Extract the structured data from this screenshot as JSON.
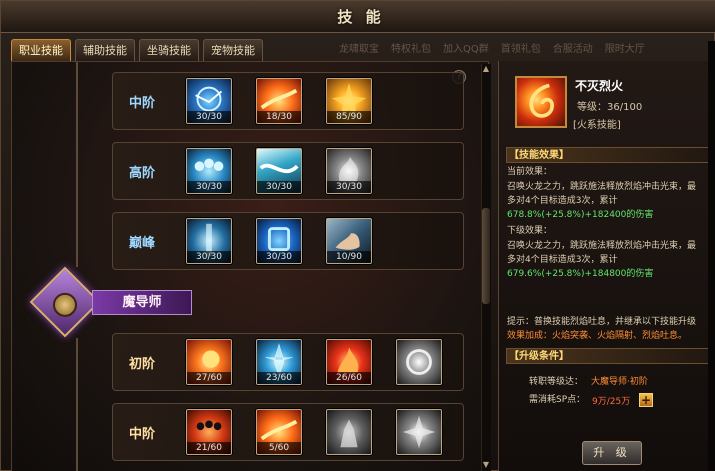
{
  "window": {
    "title": "技 能"
  },
  "tabs": [
    "职业技能",
    "辅助技能",
    "坐骑技能",
    "宠物技能"
  ],
  "top_strip": [
    "龙啸取宝",
    "特权礼包",
    "加入QQ群",
    "首领礼包",
    "合服活动",
    "限时大厅"
  ],
  "help": "?",
  "class_name": "魔导师",
  "tiers": [
    {
      "name": "中阶",
      "skills": [
        {
          "level": "30/30",
          "icon": "lightning-orb-icon"
        },
        {
          "level": "18/30",
          "icon": "fire-slash-icon"
        },
        {
          "level": "85/90",
          "icon": "golden-burst-icon"
        }
      ]
    },
    {
      "name": "高阶",
      "skills": [
        {
          "level": "30/30",
          "icon": "group-buff-icon"
        },
        {
          "level": "30/30",
          "icon": "wind-wave-icon"
        },
        {
          "level": "30/30",
          "icon": "smoke-strike-icon"
        }
      ]
    },
    {
      "name": "巅峰",
      "skills": [
        {
          "level": "30/30",
          "icon": "blue-pillar-icon"
        },
        {
          "level": "30/30",
          "icon": "blue-shield-icon"
        },
        {
          "level": "10/90",
          "icon": "strength-arm-icon"
        }
      ]
    },
    {
      "name": "初阶",
      "skills": [
        {
          "level": "27/60",
          "icon": "fireball-icon"
        },
        {
          "level": "23/60",
          "icon": "ice-shards-icon"
        },
        {
          "level": "26/60",
          "icon": "flame-burst-icon"
        },
        {
          "level": "",
          "icon": "locked-vortex-icon"
        }
      ]
    },
    {
      "name": "中阶",
      "skills": [
        {
          "level": "21/60",
          "icon": "fire-army-icon"
        },
        {
          "level": "5/60",
          "icon": "fire-slash-icon"
        },
        {
          "level": "",
          "icon": "locked-warrior-icon"
        },
        {
          "level": "",
          "icon": "locked-burst-icon"
        }
      ]
    }
  ],
  "detail": {
    "name": "不灭烈火",
    "level": "等级：36/100",
    "type": "[火系技能]",
    "effect_header": "【技能效果】",
    "current_title": "当前效果：",
    "current_desc_1": "召唤火龙之力，跳跃施法释放烈焰冲击光束，最",
    "current_desc_2": "多对4个目标造成3次，累计",
    "current_damage": "678.8%(+25.8%)+182400的伤害",
    "next_title": "下级效果：",
    "next_desc_1": "召唤火龙之力，跳跃施法释放烈焰冲击光束，最",
    "next_desc_2": "多对4个目标造成3次，累计",
    "next_damage": "679.6%(+25.8%)+184800的伤害",
    "tip_1": "提示：普换技能烈焰吐息，并继承以下技能升级",
    "tip_2": "效果加成：火焰突袭、火焰隔射、烈焰吐息。",
    "req_header": "【升级条件】",
    "req_level_label": "转职等级达：",
    "req_level_value": "大魔导师·初阶",
    "req_points_label": "需消耗SP点：",
    "req_points_value": "9万/25万",
    "plus": "+",
    "upgrade_button": "升 级"
  },
  "colors": {
    "tab_active": "#c98a3f",
    "highlight": "#62e56e",
    "warning": "#ff8d35"
  }
}
